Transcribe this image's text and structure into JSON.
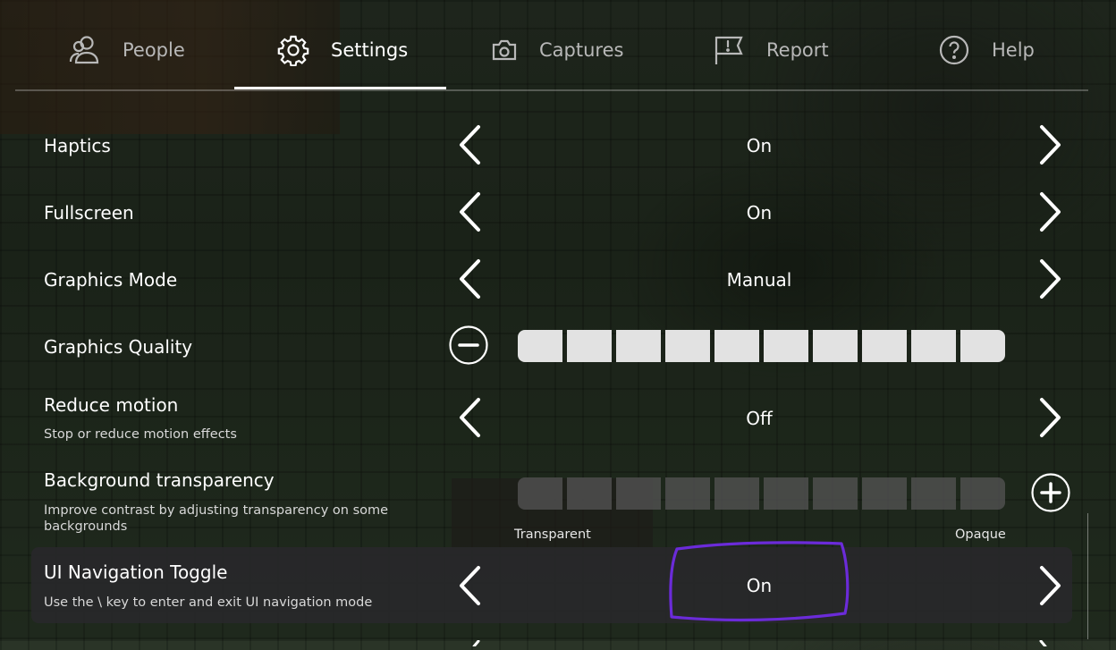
{
  "tabs": [
    {
      "label": "People",
      "icon": "people-icon"
    },
    {
      "label": "Settings",
      "icon": "gear-icon",
      "active": true
    },
    {
      "label": "Captures",
      "icon": "camera-icon"
    },
    {
      "label": "Report",
      "icon": "flag-icon"
    },
    {
      "label": "Help",
      "icon": "help-icon"
    }
  ],
  "settings": {
    "haptics": {
      "label": "Haptics",
      "value": "On"
    },
    "fullscreen": {
      "label": "Fullscreen",
      "value": "On"
    },
    "graphics_mode": {
      "label": "Graphics Mode",
      "value": "Manual"
    },
    "graphics_quality": {
      "label": "Graphics Quality",
      "level": 10,
      "max": 10
    },
    "reduce_motion": {
      "label": "Reduce motion",
      "description": "Stop or reduce motion effects",
      "value": "Off"
    },
    "background_transparency": {
      "label": "Background transparency",
      "description": "Improve contrast by adjusting transparency on some backgrounds",
      "level": 0,
      "max": 10,
      "min_label": "Transparent",
      "max_label": "Opaque"
    },
    "ui_navigation_toggle": {
      "label": "UI Navigation Toggle",
      "description": "Use the \\ key to enter and exit UI navigation mode",
      "value": "On"
    }
  },
  "colors": {
    "annotation": "#6b2bd9",
    "accent": "#ffffff"
  }
}
